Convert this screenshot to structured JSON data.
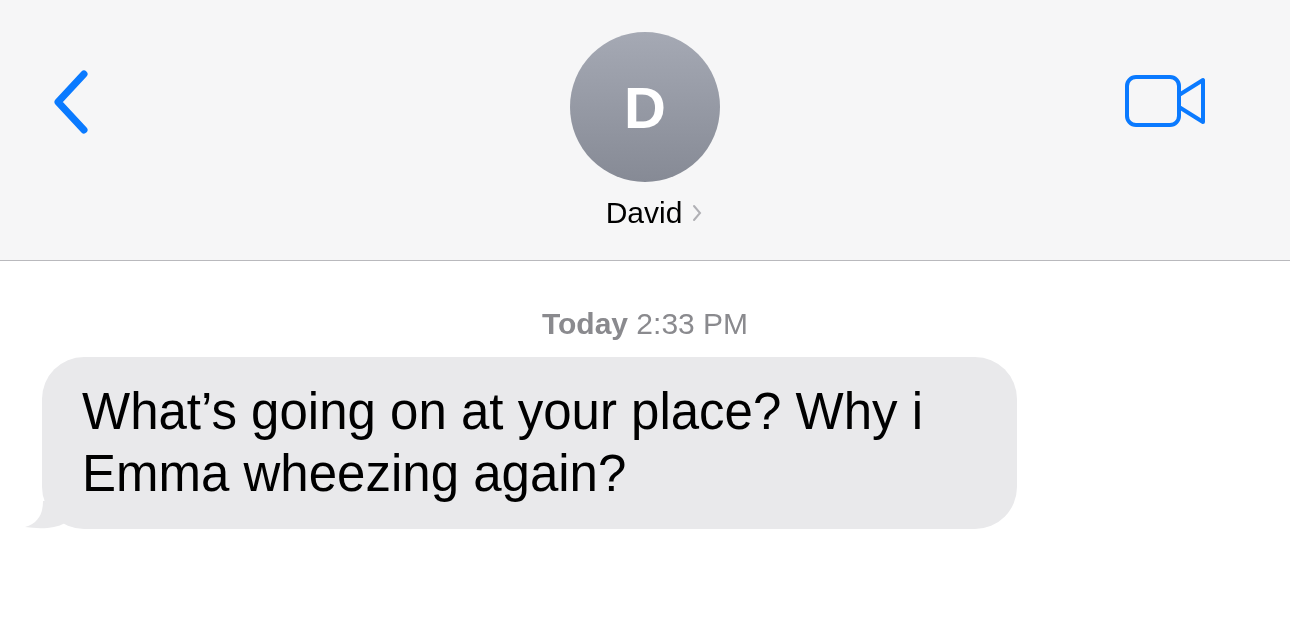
{
  "header": {
    "contact": {
      "initial": "D",
      "name": "David"
    }
  },
  "timestamp": "**Today** 2:33 PM",
  "messages": [
    {
      "kind": "received",
      "text": "What’s going on at your place? Why i Emma wheezing again?"
    }
  ]
}
